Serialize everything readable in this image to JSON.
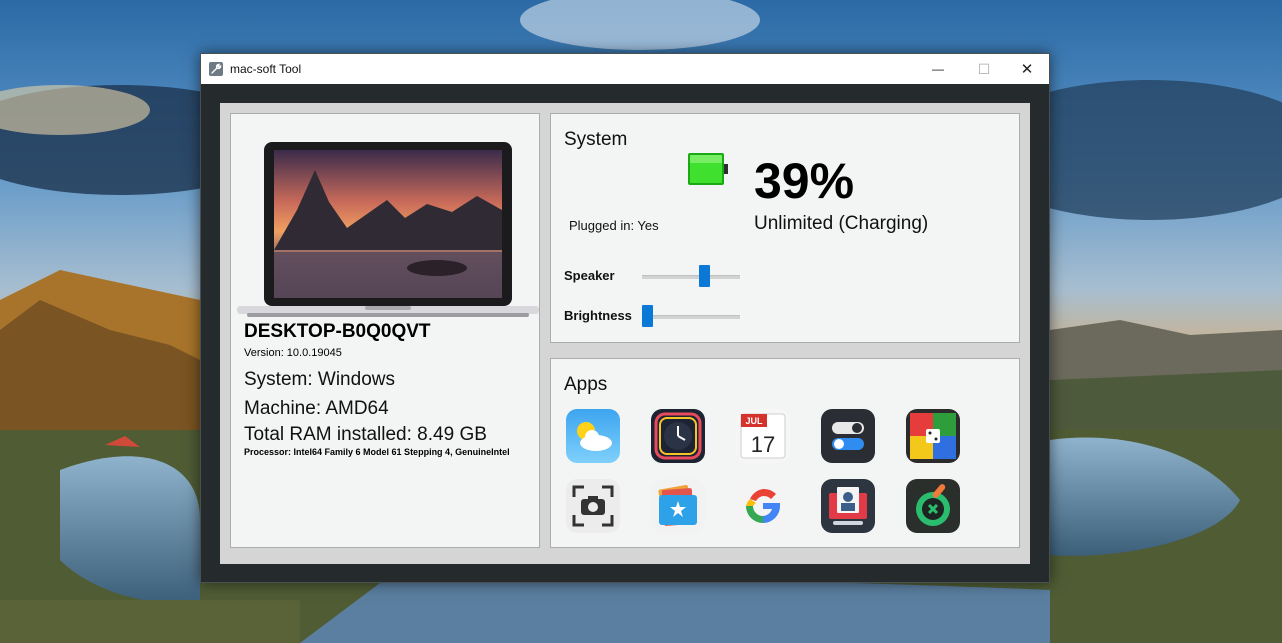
{
  "window": {
    "title": "mac-soft Tool",
    "minimize_glyph": "—",
    "maximize_glyph": "☐",
    "close_glyph": "✕"
  },
  "device": {
    "hostname": "DESKTOP-B0Q0QVT",
    "version": "Version: 10.0.19045",
    "system": "System: Windows",
    "machine": "Machine: AMD64",
    "ram": "Total RAM installed: 8.49 GB",
    "processor": "Processor: Intel64 Family 6 Model 61 Stepping 4, GenuineIntel"
  },
  "system": {
    "title": "System",
    "battery_percent_text": "39%",
    "battery_level": 0.39,
    "battery_status": "Unlimited (Charging)",
    "plugged_in": "Plugged in: Yes",
    "speaker_label": "Speaker",
    "speaker_level": 0.65,
    "brightness_label": "Brightness",
    "brightness_level": 0.0
  },
  "apps": {
    "title": "Apps",
    "items": [
      {
        "icon": "weather-icon"
      },
      {
        "icon": "clock-icon"
      },
      {
        "icon": "calendar-icon",
        "month": "JUL",
        "day": "17"
      },
      {
        "icon": "toggle-icon"
      },
      {
        "icon": "ludo-game-icon"
      },
      {
        "icon": "screenshot-icon"
      },
      {
        "icon": "files-icon"
      },
      {
        "icon": "google-icon",
        "letter": "G"
      },
      {
        "icon": "photo-booth-icon"
      },
      {
        "icon": "cleaner-icon"
      }
    ]
  },
  "colors": {
    "accent": "#0a78d7",
    "window_frame": "#252a2c",
    "panel_bg": "#f3f4f4",
    "battery_green": "#22c51a"
  }
}
